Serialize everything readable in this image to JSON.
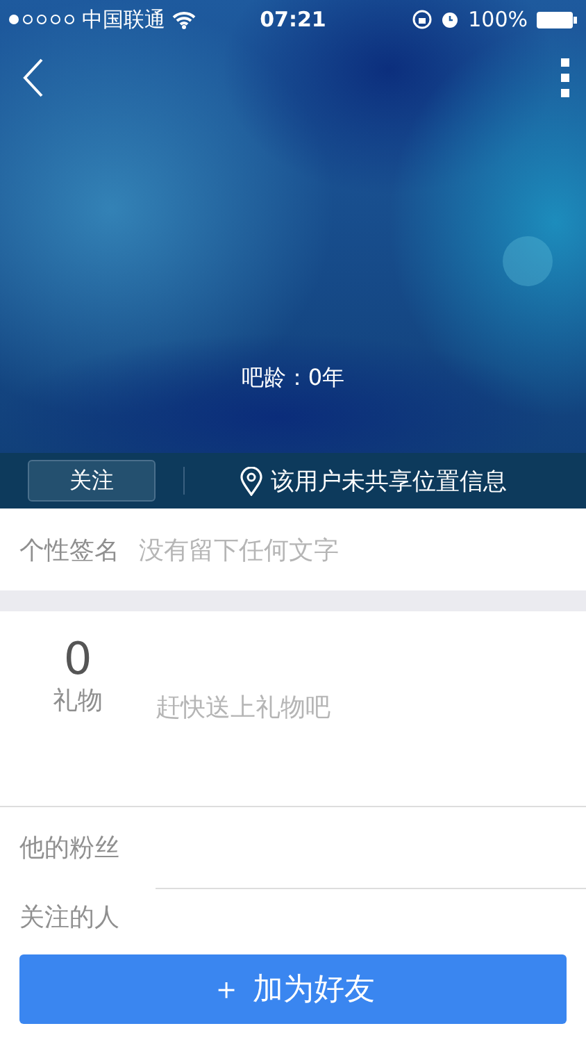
{
  "status_bar": {
    "carrier": "中国联通",
    "time": "07:21",
    "battery": "100%"
  },
  "profile": {
    "age_label": "吧龄：0年"
  },
  "action_bar": {
    "follow_button": "关注",
    "location": "该用户未共享位置信息"
  },
  "signature": {
    "label": "个性签名",
    "value": "没有留下任何文字"
  },
  "gifts": {
    "count": "0",
    "label": "礼物",
    "hint": "赶快送上礼物吧"
  },
  "rows": [
    {
      "label": "他的粉丝"
    },
    {
      "label": "关注的人"
    }
  ],
  "add_friend_button": {
    "icon": "＋",
    "label": "加为好友"
  }
}
